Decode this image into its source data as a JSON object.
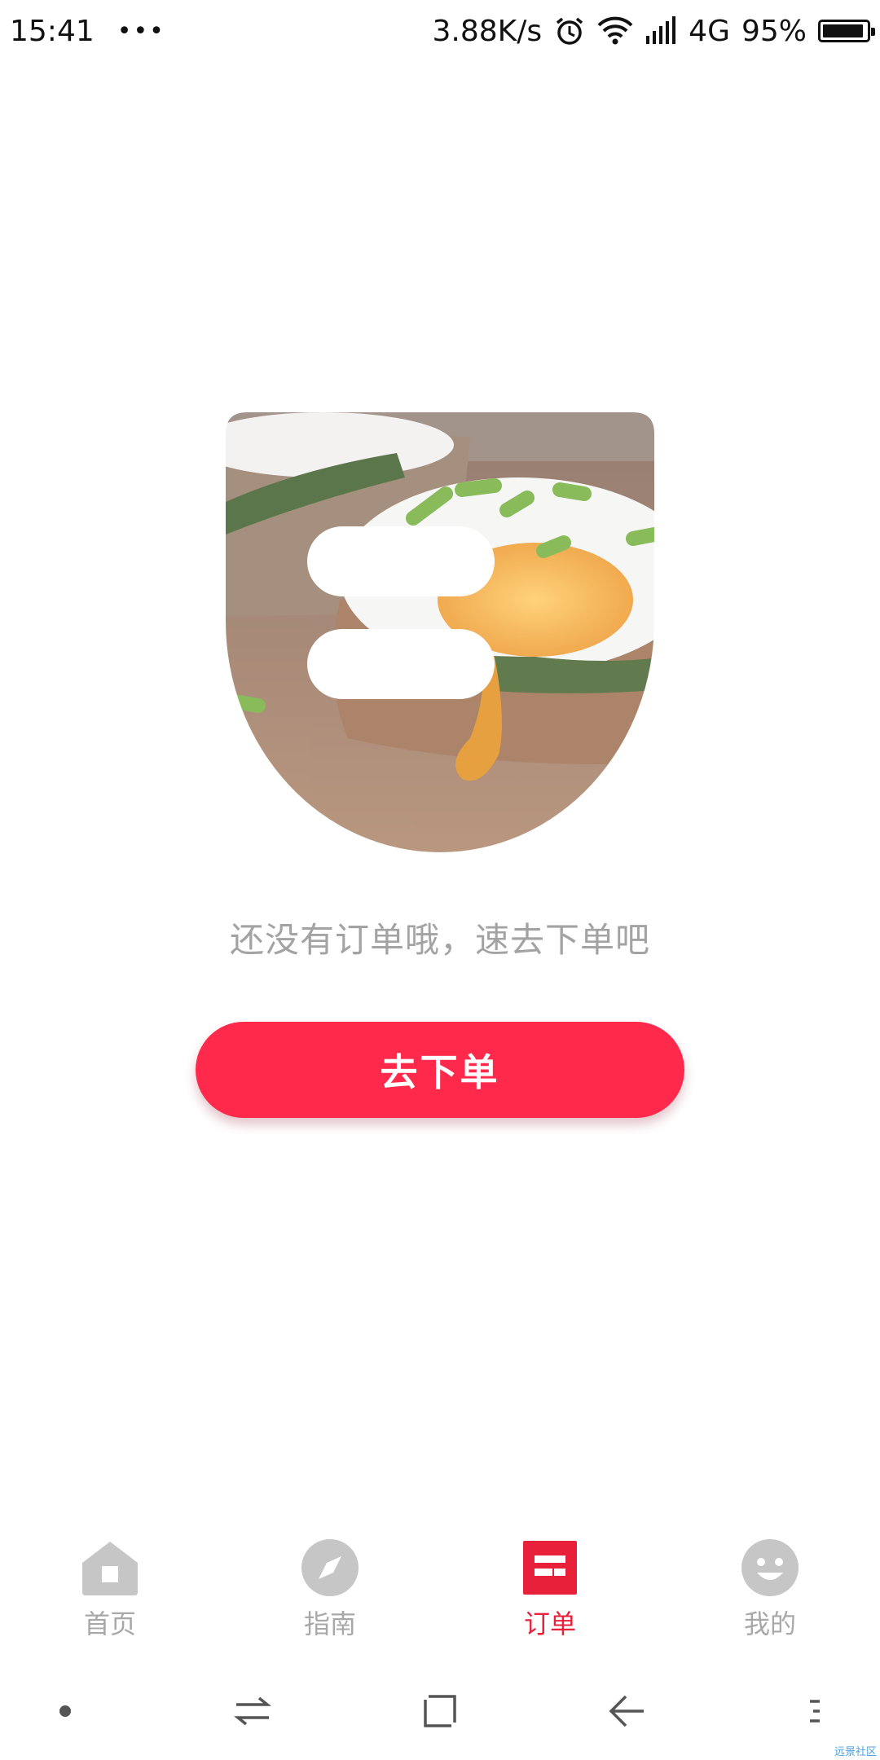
{
  "status_bar": {
    "time": "15:41",
    "dots": "•••",
    "speed": "3.88K/s",
    "network": "4G",
    "battery": "95%",
    "battery_level": 0.95,
    "icons": [
      "alarm-icon",
      "wifi-icon",
      "signal-icon",
      "battery-icon"
    ]
  },
  "empty_state": {
    "message": "还没有订单哦，速去下单吧",
    "button_label": "去下单"
  },
  "tabs": [
    {
      "label": "首页",
      "icon": "home-icon",
      "active": false
    },
    {
      "label": "指南",
      "icon": "compass-icon",
      "active": false
    },
    {
      "label": "订单",
      "icon": "order-icon",
      "active": true
    },
    {
      "label": "我的",
      "icon": "smiley-icon",
      "active": false
    }
  ],
  "nav_bar": {
    "icons": [
      "dot-icon",
      "switch-icon",
      "home-square-icon",
      "back-icon",
      "menu-icon"
    ]
  },
  "colors": {
    "accent": "#ff2a4b",
    "active_tab": "#e8203a",
    "inactive_tab": "#a8a8a8"
  },
  "watermark": "远景社区"
}
